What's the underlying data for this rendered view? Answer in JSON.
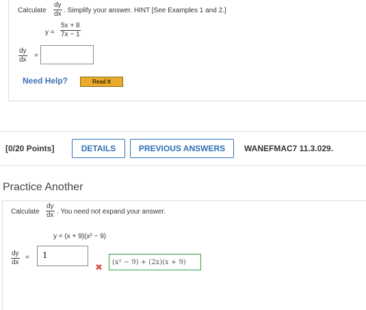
{
  "question": {
    "calculate": "Calculate",
    "deriv_num": "dy",
    "deriv_den": "dx",
    "instruction": ". Simplify your answer. HINT [See Examples 1 and 2.]",
    "y_equals": "y =",
    "fn_num": "5x + 8",
    "fn_den": "7x − 1",
    "answer_eq": "=",
    "answer_value": "",
    "need_help": "Need Help?",
    "read_it": "Read It"
  },
  "toolbar": {
    "points": "[0/20 Points]",
    "details": "DETAILS",
    "previous_answers": "PREVIOUS ANSWERS",
    "code": "WANEFMAC7 11.3.029."
  },
  "practice": {
    "title": "Practice Another",
    "calculate": "Calculate",
    "deriv_num": "dy",
    "deriv_den": "dx",
    "instruction": ". You need not expand your answer.",
    "function": "y = (x + 9)(x² − 9)",
    "answer_eq": "=",
    "answer_value": "1",
    "incorrect_icon": "x-mark-icon",
    "feedback": "(x² − 9) + (2x)(x + 9)"
  },
  "colors": {
    "link_blue": "#2f6fb5",
    "read_it_bg": "#e8a92c",
    "incorrect_red": "#d9534f",
    "correct_green": "#3c9a3c"
  }
}
